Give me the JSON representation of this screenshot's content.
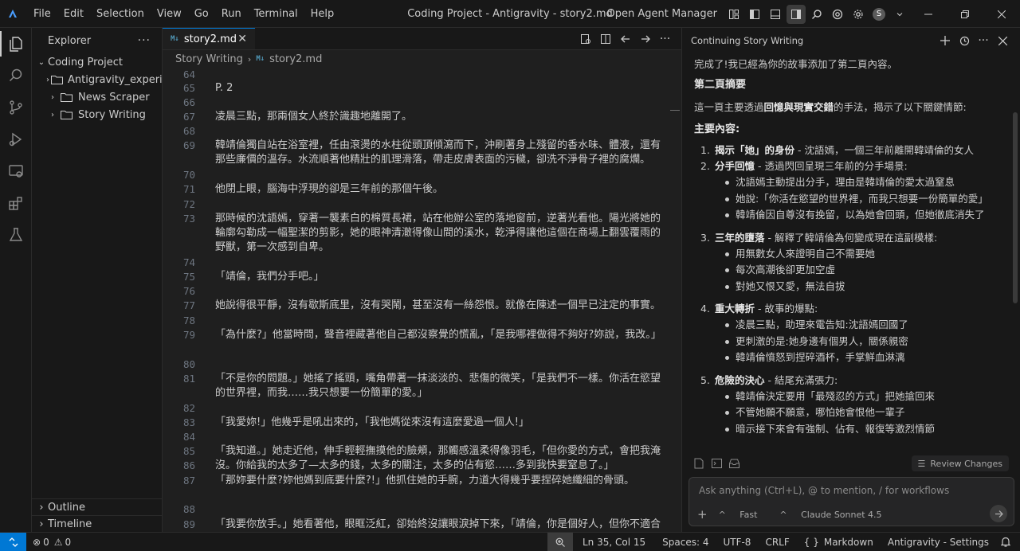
{
  "titlebar": {
    "menu": [
      "File",
      "Edit",
      "Selection",
      "View",
      "Go",
      "Run",
      "Terminal",
      "Help"
    ],
    "window_title": "Coding Project - Antigravity - story2.md",
    "agent_manager": "Open Agent Manager",
    "avatar_letter": "S"
  },
  "sidebar": {
    "title": "Explorer",
    "root": "Coding Project",
    "folders": [
      "Antigravity_experi...",
      "News Scraper",
      "Story Writing"
    ],
    "outline": "Outline",
    "timeline": "Timeline"
  },
  "editor": {
    "tab_label": "story2.md",
    "tab_icon": "M↓",
    "breadcrumb": [
      "Story Writing",
      "story2.md"
    ],
    "lines": [
      {
        "n": "64",
        "t": ""
      },
      {
        "n": "65",
        "t": "P. 2"
      },
      {
        "n": "66",
        "t": ""
      },
      {
        "n": "67",
        "t": "凌晨三點，那兩個女人終於識趣地離開了。"
      },
      {
        "n": "68",
        "t": ""
      },
      {
        "n": "69",
        "t": "韓靖倫獨自站在浴室裡，任由滾燙的水柱從頭頂傾瀉而下，沖刷著身上殘留的香水味、體液，還有那些廉價的溫存。水流順著他精壯的肌理滑落，帶走皮膚表面的污穢，卻洗不淨骨子裡的腐爛。"
      },
      {
        "n": "70",
        "t": ""
      },
      {
        "n": "71",
        "t": "他閉上眼，腦海中浮現的卻是三年前的那個午後。"
      },
      {
        "n": "72",
        "t": ""
      },
      {
        "n": "73",
        "t": "那時候的沈語嫣，穿著一襲素白的棉質長裙，站在他辦公室的落地窗前，逆著光看他。陽光將她的輪廓勾勒成一幅聖潔的剪影，她的眼神清澈得像山間的溪水，乾淨得讓他這個在商場上翻雲覆雨的野獸，第一次感到自卑。"
      },
      {
        "n": "74",
        "t": ""
      },
      {
        "n": "75",
        "t": "「靖倫，我們分手吧。」"
      },
      {
        "n": "76",
        "t": ""
      },
      {
        "n": "77",
        "t": "她說得很平靜，沒有歇斯底里，沒有哭鬧，甚至沒有一絲怨恨。就像在陳述一個早已注定的事實。"
      },
      {
        "n": "78",
        "t": ""
      },
      {
        "n": "79",
        "t": "「為什麼?」他當時問，聲音裡藏著他自己都沒察覺的慌亂，「是我哪裡做得不夠好?妳說，我改。」"
      },
      {
        "n": "80",
        "t": ""
      },
      {
        "n": "81",
        "t": "「不是你的問題。」她搖了搖頭，嘴角帶著一抹淡淡的、悲傷的微笑，「是我們不一樣。你活在慾望的世界裡，而我……我只想要一份簡單的愛。」"
      },
      {
        "n": "82",
        "t": ""
      },
      {
        "n": "83",
        "t": "「我愛妳!」他幾乎是吼出來的，「我他媽從來沒有這麼愛過一個人!」"
      },
      {
        "n": "84",
        "t": ""
      },
      {
        "n": "85",
        "t": "「我知道。」她走近他，伸手輕輕撫摸他的臉頰，那觸感溫柔得像羽毛，「但你愛的方式，會把我淹沒。你給我的太多了—太多的錢，太多的關注，太多的佔有慾……多到我快要窒息了。」"
      },
      {
        "n": "86",
        "t": ""
      },
      {
        "n": "87",
        "t": "「那妳要什麼?妳他媽到底要什麼?!」他抓住她的手腕，力道大得幾乎要捏碎她纖細的骨頭。"
      },
      {
        "n": "88",
        "t": ""
      },
      {
        "n": "89",
        "t": "「我要你放手。」她看著他，眼眶泛紅，卻始終沒讓眼淚掉下來，「靖倫，你是個好人，但你不適合"
      }
    ]
  },
  "panel": {
    "title": "Continuing Story Writing",
    "intro": "完成了!我已經為你的故事添加了第二頁內容。",
    "summary_heading": "第二頁摘要",
    "summary_pre": "這一頁主要透過",
    "summary_bold": "回憶與現實交錯",
    "summary_post": "的手法，揭示了以下關鍵情節:",
    "main_heading": "主要內容:",
    "items": [
      {
        "num": "1.",
        "bold": "揭示「她」的身份",
        "rest": " - 沈語嫣，一個三年前離開韓靖倫的女人",
        "subs": []
      },
      {
        "num": "2.",
        "bold": "分手回憶",
        "rest": " - 透過閃回呈現三年前的分手場景:",
        "subs": [
          "沈語嫣主動提出分手，理由是韓靖倫的愛太過窒息",
          "她說:「你活在慾望的世界裡，而我只想要一份簡單的愛」",
          "韓靖倫因自尊沒有挽留，以為她會回頭，但她徹底消失了"
        ]
      },
      {
        "num": "3.",
        "bold": "三年的墮落",
        "rest": " - 解釋了韓靖倫為何變成現在這副模樣:",
        "subs": [
          "用無數女人來證明自己不需要她",
          "每次高潮後卻更加空虛",
          "對她又恨又愛，無法自拔"
        ]
      },
      {
        "num": "4.",
        "bold": "重大轉折",
        "rest": " - 故事的爆點:",
        "subs": [
          "凌晨三點，助理來電告知:沈語嫣回國了",
          "更刺激的是:她身邊有個男人，關係親密",
          "韓靖倫憤怒到捏碎酒杯，手掌鮮血淋漓"
        ]
      },
      {
        "num": "5.",
        "bold": "危險的決心",
        "rest": " - 結尾充滿張力:",
        "subs": [
          "韓靖倫決定要用「最殘忍的方式」把她搶回來",
          "不管她願不願意，哪怕她會恨他一輩子",
          "暗示接下來會有強制、佔有、報復等激烈情節"
        ]
      }
    ],
    "review_changes": "Review Changes",
    "input_placeholder": "Ask anything (Ctrl+L), @ to mention, / for workflows",
    "mode": "Fast",
    "model": "Claude Sonnet 4.5"
  },
  "statusbar": {
    "problems": "0",
    "warnings": "0",
    "position": "Ln 35, Col 15",
    "spaces": "Spaces: 4",
    "encoding": "UTF-8",
    "eol": "CRLF",
    "language": "Markdown",
    "settings": "Antigravity - Settings"
  },
  "colors": {
    "accent": "#0078d4",
    "background": "#1f1f1f",
    "chrome": "#181818"
  }
}
